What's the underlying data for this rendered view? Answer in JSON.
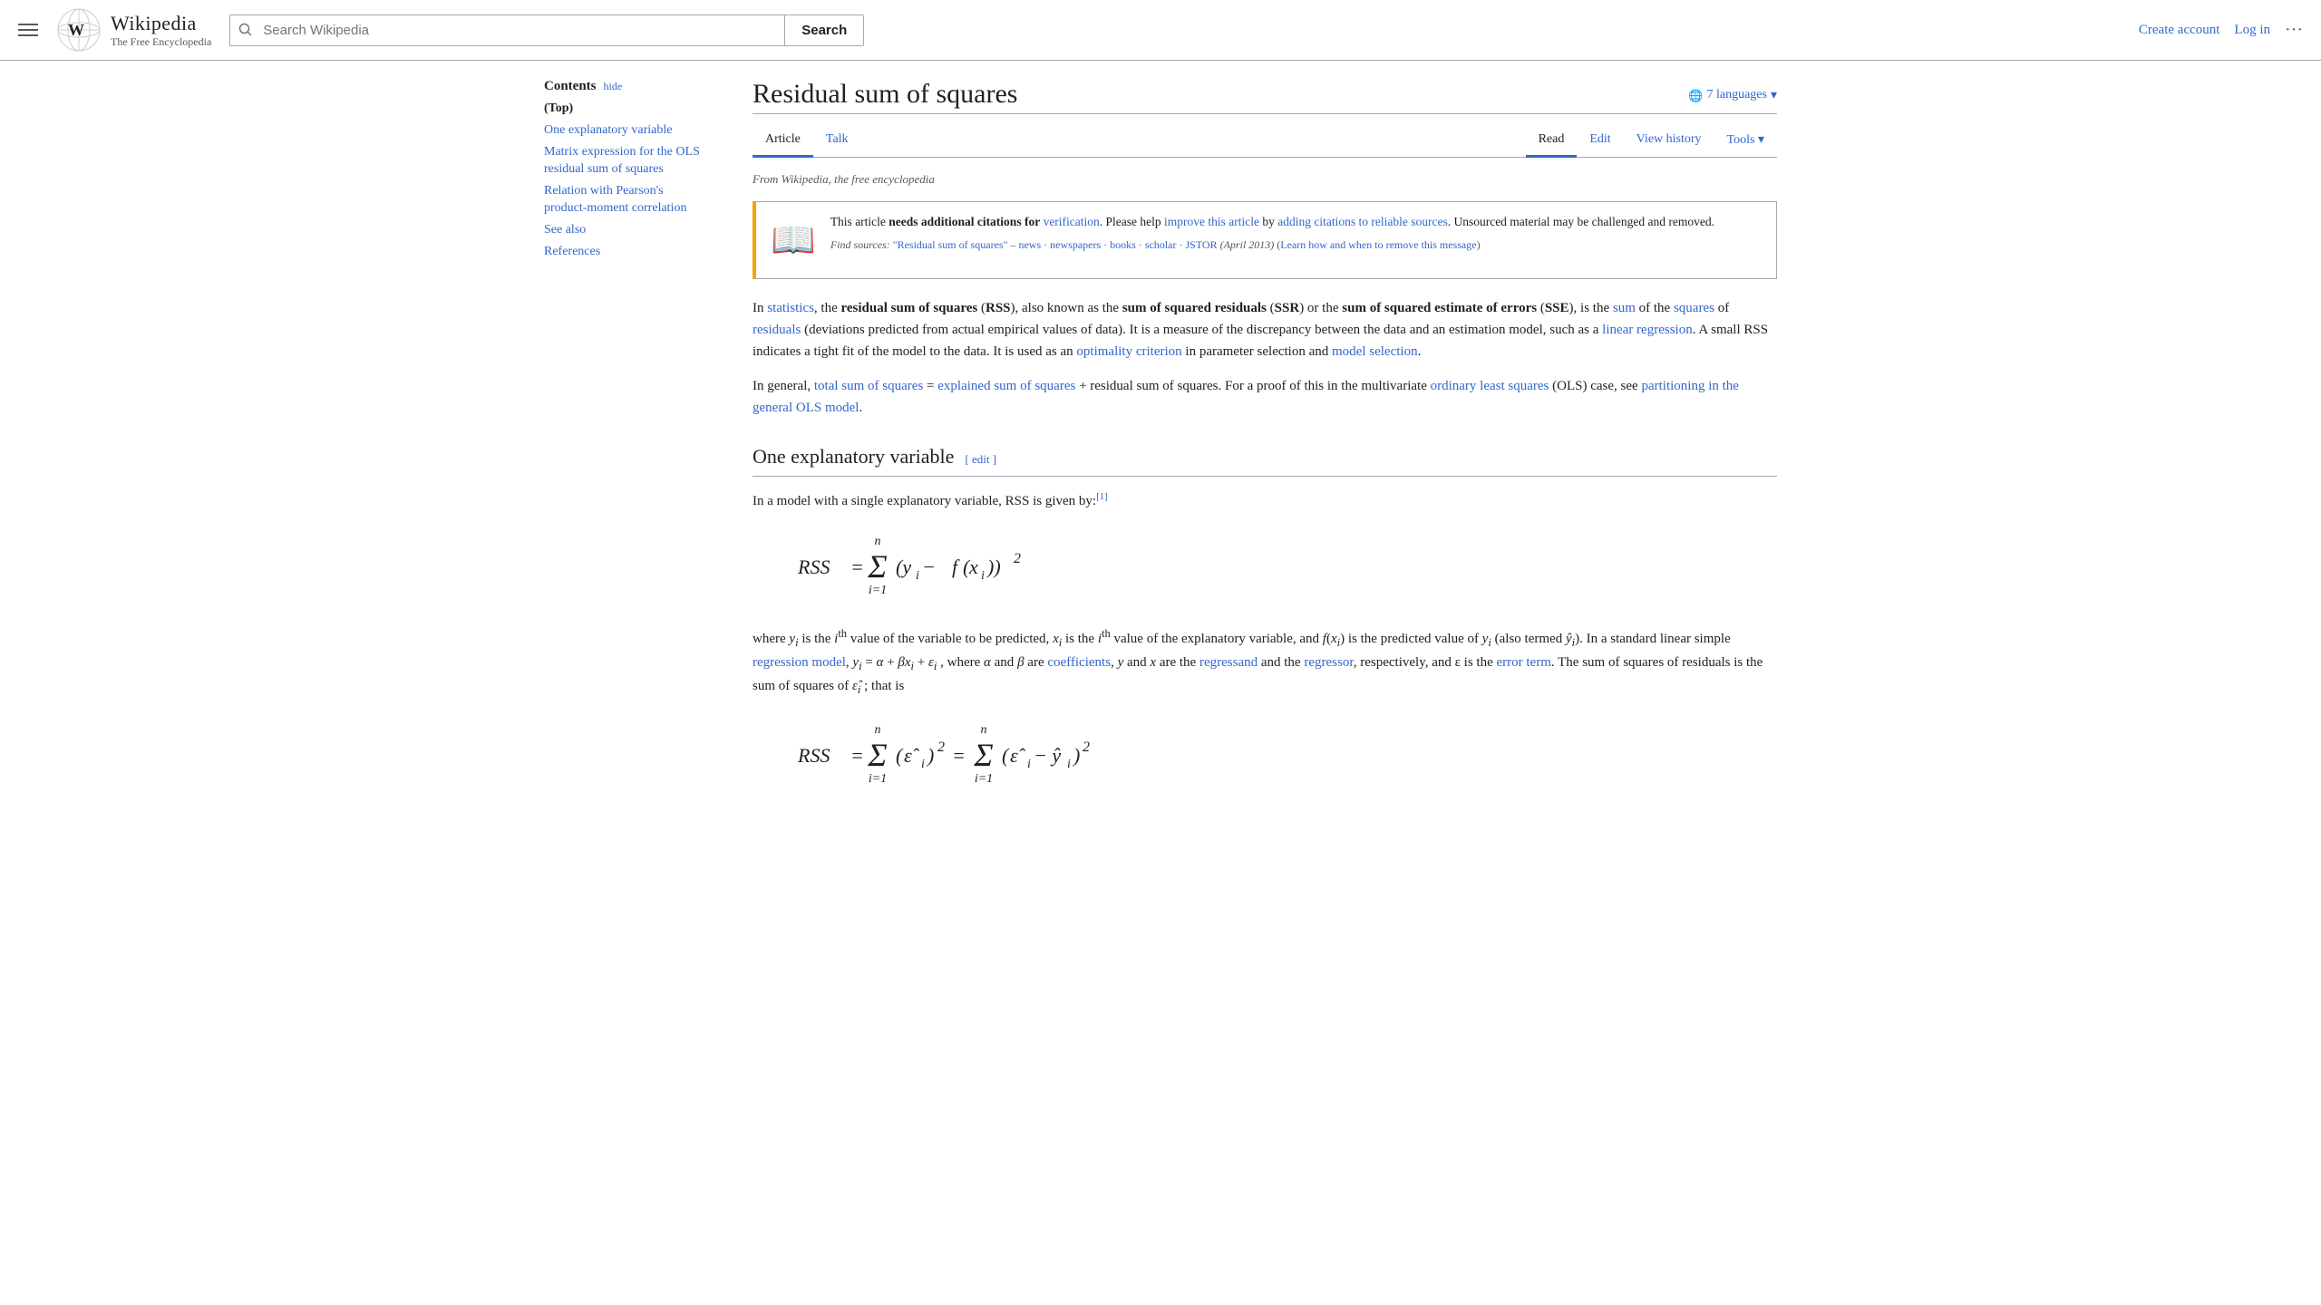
{
  "header": {
    "logo_title": "Wikipedia",
    "logo_subtitle": "The Free Encyclopedia",
    "search_placeholder": "Search Wikipedia",
    "search_button": "Search",
    "create_account": "Create account",
    "log_in": "Log in"
  },
  "article": {
    "title": "Residual sum of squares",
    "from_text": "From Wikipedia, the free encyclopedia",
    "languages_label": "7 languages",
    "tabs": {
      "article": "Article",
      "talk": "Talk",
      "read": "Read",
      "edit": "Edit",
      "view_history": "View history",
      "tools": "Tools"
    }
  },
  "toc": {
    "title": "Contents",
    "hide_label": "hide",
    "top_label": "(Top)",
    "items": [
      {
        "label": "One explanatory variable"
      },
      {
        "label": "Matrix expression for the OLS residual sum of squares"
      },
      {
        "label": "Relation with Pearson's product-moment correlation"
      },
      {
        "label": "See also"
      },
      {
        "label": "References"
      }
    ]
  },
  "citation_box": {
    "icon": "📖",
    "text_pre": "This article ",
    "text_bold": "needs additional citations for",
    "verification": "verification",
    "text_post": ". Please help ",
    "improve": "improve this article",
    "by_text": " by ",
    "adding": "adding citations to reliable sources",
    "unsourced": ". Unsourced material may be challenged and removed.",
    "find_sources": "Find sources:",
    "source_query": "\"Residual sum of squares\"",
    "sources": [
      "news",
      "newspapers",
      "books",
      "scholar",
      "JSTOR"
    ],
    "date": "(April 2013)",
    "learn": "(Learn how and when to remove this message)"
  },
  "body": {
    "intro": {
      "p1_pre": "In ",
      "statistics_link": "statistics",
      "p1_mid": ", the ",
      "p1_bold1": "residual sum of squares",
      "p1_rss": "RSS",
      "p1_also": "), also known as the ",
      "p1_bold2": "sum of squared residuals",
      "p1_ssr": "SSR",
      "p1_or": ") or the ",
      "p1_bold3": "sum of squared estimate of errors",
      "p1_sse": "SSE",
      "p1_is": "), is the ",
      "sum_link": "sum",
      "squares_link": "squares",
      "residuals_link": "residuals",
      "p1_rest": "(deviations predicted from actual empirical values of data). It is a measure of the discrepancy between the data and an estimation model, such as a ",
      "linear_reg": "linear regression",
      "p1_small": ". A small RSS indicates a tight fit of the model to the data. It is used as an ",
      "optimality": "optimality criterion",
      "p1_param": " in parameter selection and ",
      "model_sel": "model selection",
      "p1_end": ".",
      "p2_pre": "In general, ",
      "total_sum": "total sum of squares",
      "equals": "=",
      "explained_sum": "explained sum of squares",
      "plus_rest": "+ residual sum of squares. For a proof of this in the multivariate ",
      "ordinary_ls": "ordinary least squares",
      "p2_rest": "(OLS) case, see ",
      "partitioning": "partitioning in the general OLS model",
      "p2_end": "."
    },
    "section1": {
      "title": "One explanatory variable",
      "edit_label": "edit",
      "p1": "In a model with a single explanatory variable, RSS is given by:",
      "ref1": "[1]",
      "formula_display": "RSS = Σ(yᵢ − f(xᵢ))²",
      "p2_pre": "where ",
      "yi": "yᵢ",
      "p2_ith": " is the i",
      "th": "th",
      "p2_var": " value of the variable to be predicted, ",
      "xi": "xᵢ",
      "p2_xi_ith": " is the i",
      "p2_exp": "th",
      "p2_exp_val": " value of the explanatory variable, and ",
      "p2_f": "f(xᵢ)",
      "p2_predicted": " is the predicted value of ",
      "p2_yi2": "yᵢ",
      "p2_also": " (also termed ",
      "p2_yhat": "ŷᵢ",
      "p2_std": "). In a standard linear simple ",
      "reg_model": "regression model",
      "p2_eq": ", yᵢ = α + βxᵢ + εᵢ , where α and β are ",
      "coefficients": "coefficients",
      "p2_xy": ", y and x are the ",
      "regressand": "regressand",
      "p2_and": " and the ",
      "regressor": "regressor",
      "p2_eps": ", respectively, and ε is the ",
      "error_term": "error term",
      "p2_sum": ". The sum of squares of residuals is the sum of squares of",
      "epsilon_i": "ε̂ᵢ",
      "p2_end": "; that is"
    }
  }
}
